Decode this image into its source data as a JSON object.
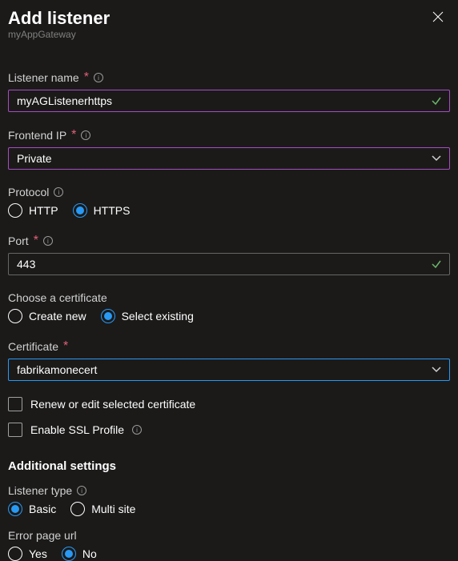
{
  "header": {
    "title": "Add listener",
    "subtitle": "myAppGateway"
  },
  "listenerName": {
    "label": "Listener name",
    "required": "*",
    "value": "myAGListenerhttps"
  },
  "frontendIp": {
    "label": "Frontend IP",
    "required": "*",
    "value": "Private"
  },
  "protocol": {
    "label": "Protocol",
    "options": {
      "http": "HTTP",
      "https": "HTTPS"
    }
  },
  "port": {
    "label": "Port",
    "required": "*",
    "value": "443"
  },
  "chooseCert": {
    "label": "Choose a certificate",
    "options": {
      "createNew": "Create new",
      "selectExisting": "Select existing"
    }
  },
  "certificate": {
    "label": "Certificate",
    "required": "*",
    "value": "fabrikamonecert"
  },
  "renewCheck": {
    "label": "Renew or edit selected certificate"
  },
  "sslProfileCheck": {
    "label": "Enable SSL Profile"
  },
  "additionalSettings": {
    "heading": "Additional settings"
  },
  "listenerType": {
    "label": "Listener type",
    "options": {
      "basic": "Basic",
      "multiSite": "Multi site"
    }
  },
  "errorPage": {
    "label": "Error page url",
    "options": {
      "yes": "Yes",
      "no": "No"
    }
  }
}
